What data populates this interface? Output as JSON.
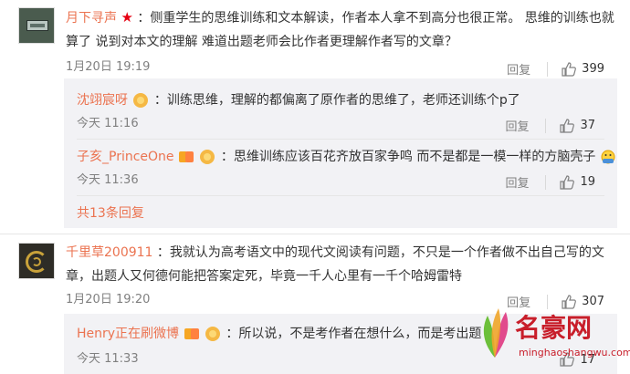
{
  "comments": [
    {
      "username": "月下寻声",
      "text_line1": "：侧重学生的思维训练和文本解读，作者本人拿不到高分也很正常。 思维的训练也就",
      "text_line2": "算了 说到对本文的理解 难道出题老师会比作者更理解作者写的文章？",
      "timestamp": "1月20日 19:19",
      "reply_label": "回复",
      "likes": "399",
      "replies": [
        {
          "username": "沈翊宸呀",
          "text": "：训练思维，理解的都偏离了原作者的思维了，老师还训练个p了",
          "timestamp": "今天 11:16",
          "reply_label": "回复",
          "likes": "37"
        },
        {
          "username": "子亥_PrinceOne",
          "text": "：思维训练应该百花齐放百家争鸣 而不是都是一模一样的方脑壳子",
          "timestamp": "今天 11:36",
          "reply_label": "回复",
          "likes": "19"
        }
      ],
      "more_replies": "共13条回复"
    },
    {
      "username": "千里草200911",
      "text_line1": "：我就认为高考语文中的现代文阅读有问题，不只是一个作者做不出自己写的文",
      "text_line2": "章，出题人又何德何能把答案定死，毕竟一千人心里有一千个哈姆雷特",
      "timestamp": "1月20日 19:20",
      "reply_label": "回复",
      "likes": "307",
      "replies": [
        {
          "username": "Henry正在刷微博",
          "text": "：所以说，不是考作者在想什么，而是考出题",
          "timestamp": "今天 11:33",
          "likes": "17"
        }
      ]
    }
  ],
  "watermark": {
    "text": "名豪网",
    "url": "minghaoshangwu.com"
  },
  "icons": {
    "like": "thumbs-up-icon",
    "star": "star-icon",
    "badge": "vip-badge-icon"
  },
  "colors": {
    "username": "#eb7350",
    "text": "#333333",
    "meta": "#808080",
    "sub_bg": "#f2f2f5",
    "star": "#e60012"
  }
}
